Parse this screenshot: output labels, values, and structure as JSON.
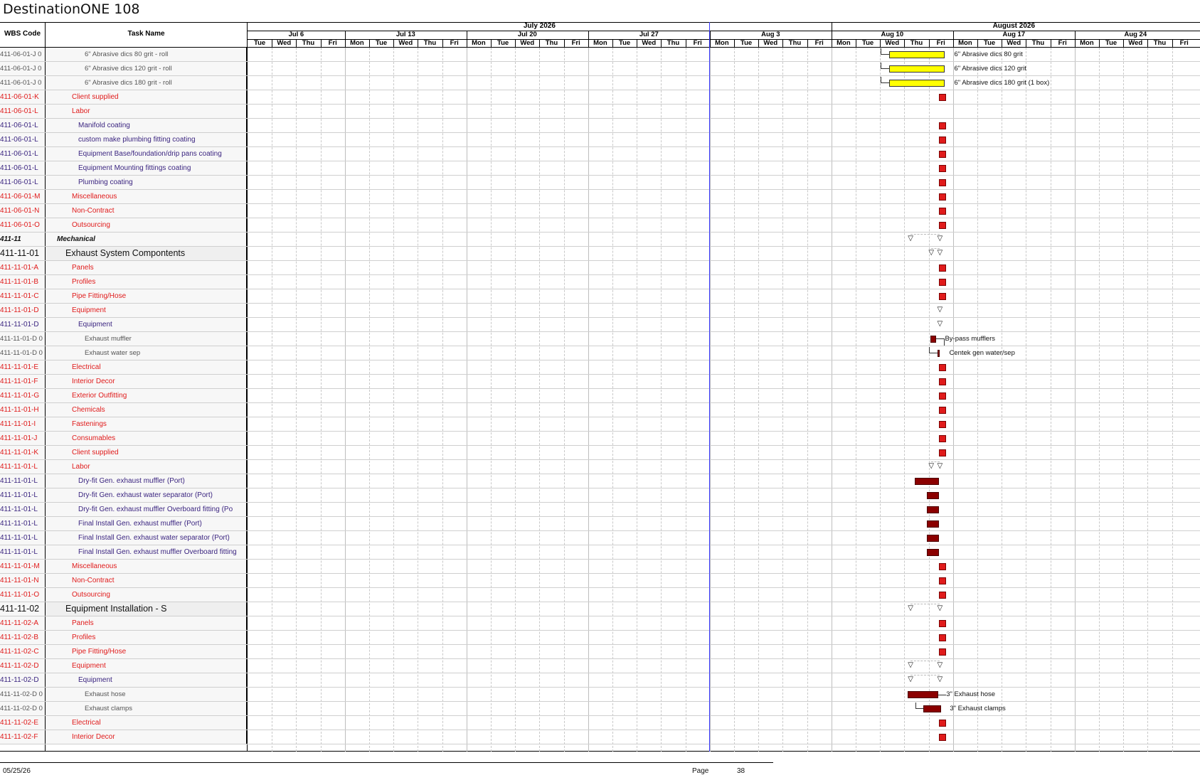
{
  "title": "DestinationONE 108",
  "columns": {
    "wbs": "WBS Code",
    "task": "Task Name"
  },
  "months": [
    "July 2026",
    "August 2026"
  ],
  "weeks": [
    "Jul 6",
    "Jul 13",
    "Jul 20",
    "Jul 27",
    "Aug 3",
    "Aug 10",
    "Aug 17",
    "Aug 24"
  ],
  "day_labels": [
    "Tue",
    "Wed",
    "Thu",
    "Fri",
    "Mon",
    "Tue",
    "Wed",
    "Thu",
    "Fri",
    "Mon",
    "Tue",
    "Wed",
    "Thu",
    "Fri",
    "Mon",
    "Tue",
    "Wed",
    "Thu",
    "Fri",
    "Mon",
    "Tue",
    "Wed",
    "Thu",
    "Fri",
    "Mon",
    "Tue",
    "Wed",
    "Thu",
    "Fri",
    "Mon",
    "Tue",
    "Wed",
    "Thu",
    "Fri",
    "Mon",
    "Tue",
    "Wed",
    "Thu",
    "Fri"
  ],
  "rows": [
    {
      "wbs": "411-06-01-J 0",
      "task": "6\" Abrasive dics 80 grit - roll",
      "style": "gray",
      "indent": 3,
      "bar": {
        "type": "yellow",
        "label": "6\" Abrasive dics 80 grit"
      }
    },
    {
      "wbs": "411-06-01-J 0",
      "task": "6\" Abrasive dics 120 grit - roll",
      "style": "gray",
      "indent": 3,
      "bar": {
        "type": "yellow",
        "label": "6\" Abrasive dics 120 grit"
      }
    },
    {
      "wbs": "411-06-01-J 0",
      "task": "6\" Abrasive dics 180 grit - roll",
      "style": "gray",
      "indent": 3,
      "bar": {
        "type": "yellow",
        "label": "6\" Abrasive dics 180 grit (1 box)"
      }
    },
    {
      "wbs": "411-06-01-K",
      "task": "Client supplied",
      "style": "red",
      "indent": 1,
      "bar": {
        "type": "red"
      }
    },
    {
      "wbs": "411-06-01-L",
      "task": "Labor",
      "style": "red",
      "indent": 1,
      "bar": null
    },
    {
      "wbs": "411-06-01-L",
      "task": "Manifold coating",
      "style": "purple",
      "indent": 2,
      "bar": {
        "type": "red"
      }
    },
    {
      "wbs": "411-06-01-L",
      "task": "custom make plumbing fitting coating",
      "style": "purple",
      "indent": 2,
      "bar": {
        "type": "red"
      }
    },
    {
      "wbs": "411-06-01-L",
      "task": "Equipment Base/foundation/drip pans coating",
      "style": "purple",
      "indent": 2,
      "bar": {
        "type": "red"
      }
    },
    {
      "wbs": "411-06-01-L",
      "task": "Equipment Mounting fittings coating",
      "style": "purple",
      "indent": 2,
      "bar": {
        "type": "red"
      }
    },
    {
      "wbs": "411-06-01-L",
      "task": "Plumbing coating",
      "style": "purple",
      "indent": 2,
      "bar": {
        "type": "red"
      }
    },
    {
      "wbs": "411-06-01-M",
      "task": "Miscellaneous",
      "style": "red",
      "indent": 1,
      "bar": {
        "type": "red"
      }
    },
    {
      "wbs": "411-06-01-N",
      "task": "Non-Contract",
      "style": "red",
      "indent": 1,
      "bar": {
        "type": "red"
      }
    },
    {
      "wbs": "411-06-01-O",
      "task": "Outsourcing",
      "style": "red",
      "indent": 1,
      "bar": {
        "type": "red"
      }
    },
    {
      "wbs": "411-11",
      "task": "Mechanical",
      "style": "section",
      "indent": 0,
      "bar": {
        "type": "summary-wide"
      }
    },
    {
      "wbs": "411-11-01",
      "task": "Exhaust System Compontents",
      "style": "group",
      "indent": 0,
      "bar": {
        "type": "summary-narrow"
      }
    },
    {
      "wbs": "411-11-01-A",
      "task": "Panels",
      "style": "red",
      "indent": 1,
      "bar": {
        "type": "red"
      }
    },
    {
      "wbs": "411-11-01-B",
      "task": "Profiles",
      "style": "red",
      "indent": 1,
      "bar": {
        "type": "red"
      }
    },
    {
      "wbs": "411-11-01-C",
      "task": "Pipe Fitting/Hose",
      "style": "red",
      "indent": 1,
      "bar": {
        "type": "red"
      }
    },
    {
      "wbs": "411-11-01-D",
      "task": "Equipment",
      "style": "red",
      "indent": 1,
      "bar": {
        "type": "summary-single"
      }
    },
    {
      "wbs": "411-11-01-D",
      "task": "Equipment",
      "style": "purple",
      "indent": 2,
      "bar": {
        "type": "summary-single"
      }
    },
    {
      "wbs": "411-11-01-D 0",
      "task": "Exhaust muffler",
      "style": "gray",
      "indent": 3,
      "bar": {
        "type": "dark-small",
        "label": "By-pass mufflers"
      }
    },
    {
      "wbs": "411-11-01-D 0",
      "task": "Exhaust water sep",
      "style": "gray",
      "indent": 3,
      "bar": {
        "type": "dark-thin",
        "label": "Centek gen water/sep"
      }
    },
    {
      "wbs": "411-11-01-E",
      "task": "Electrical",
      "style": "red",
      "indent": 1,
      "bar": {
        "type": "red"
      }
    },
    {
      "wbs": "411-11-01-F",
      "task": "Interior Decor",
      "style": "red",
      "indent": 1,
      "bar": {
        "type": "red"
      }
    },
    {
      "wbs": "411-11-01-G",
      "task": "Exterior Outfitting",
      "style": "red",
      "indent": 1,
      "bar": {
        "type": "red"
      }
    },
    {
      "wbs": "411-11-01-H",
      "task": "Chemicals",
      "style": "red",
      "indent": 1,
      "bar": {
        "type": "red"
      }
    },
    {
      "wbs": "411-11-01-I",
      "task": "Fastenings",
      "style": "red",
      "indent": 1,
      "bar": {
        "type": "red"
      }
    },
    {
      "wbs": "411-11-01-J",
      "task": "Consumables",
      "style": "red",
      "indent": 1,
      "bar": {
        "type": "red"
      }
    },
    {
      "wbs": "411-11-01-K",
      "task": "Client supplied",
      "style": "red",
      "indent": 1,
      "bar": {
        "type": "red"
      }
    },
    {
      "wbs": "411-11-01-L",
      "task": "Labor",
      "style": "red",
      "indent": 1,
      "bar": {
        "type": "summary-narrow"
      }
    },
    {
      "wbs": "411-11-01-L",
      "task": "Dry-fit Gen. exhaust muffler (Port)",
      "style": "purple",
      "indent": 2,
      "bar": {
        "type": "dark-long"
      }
    },
    {
      "wbs": "411-11-01-L",
      "task": "Dry-fit Gen. exhaust water separator (Port)",
      "style": "purple",
      "indent": 2,
      "bar": {
        "type": "dark-med"
      }
    },
    {
      "wbs": "411-11-01-L",
      "task": "Dry-fit Gen. exhaust muffler Overboard fitting (Po",
      "style": "purple",
      "indent": 2,
      "bar": {
        "type": "dark-med"
      }
    },
    {
      "wbs": "411-11-01-L",
      "task": "Final Install  Gen. exhaust muffler (Port)",
      "style": "purple",
      "indent": 2,
      "bar": {
        "type": "dark-med"
      }
    },
    {
      "wbs": "411-11-01-L",
      "task": "Final Install Gen. exhaust water separator (Port)",
      "style": "purple",
      "indent": 2,
      "bar": {
        "type": "dark-med"
      }
    },
    {
      "wbs": "411-11-01-L",
      "task": "Final Install Gen. exhaust muffler Overboard fitting",
      "style": "purple",
      "indent": 2,
      "bar": {
        "type": "dark-med"
      }
    },
    {
      "wbs": "411-11-01-M",
      "task": "Miscellaneous",
      "style": "red",
      "indent": 1,
      "bar": {
        "type": "red"
      }
    },
    {
      "wbs": "411-11-01-N",
      "task": "Non-Contract",
      "style": "red",
      "indent": 1,
      "bar": {
        "type": "red"
      }
    },
    {
      "wbs": "411-11-01-O",
      "task": "Outsourcing",
      "style": "red",
      "indent": 1,
      "bar": {
        "type": "red"
      }
    },
    {
      "wbs": "411-11-02",
      "task": "Equipment Installation - S",
      "style": "group",
      "indent": 0,
      "bar": {
        "type": "summary-wide"
      }
    },
    {
      "wbs": "411-11-02-A",
      "task": "Panels",
      "style": "red",
      "indent": 1,
      "bar": {
        "type": "red"
      }
    },
    {
      "wbs": "411-11-02-B",
      "task": "Profiles",
      "style": "red",
      "indent": 1,
      "bar": {
        "type": "red"
      }
    },
    {
      "wbs": "411-11-02-C",
      "task": "Pipe Fitting/Hose",
      "style": "red",
      "indent": 1,
      "bar": {
        "type": "red"
      }
    },
    {
      "wbs": "411-11-02-D",
      "task": "Equipment",
      "style": "red",
      "indent": 1,
      "bar": {
        "type": "summary-wide"
      }
    },
    {
      "wbs": "411-11-02-D",
      "task": "Equipment",
      "style": "purple",
      "indent": 2,
      "bar": {
        "type": "summary-wide"
      }
    },
    {
      "wbs": "411-11-02-D 0",
      "task": "Exhaust hose",
      "style": "gray",
      "indent": 3,
      "bar": {
        "type": "dark-hose",
        "label": "3\" Exhaust hose"
      }
    },
    {
      "wbs": "411-11-02-D 0",
      "task": "Exhaust clamps",
      "style": "gray",
      "indent": 3,
      "bar": {
        "type": "dark-clamps",
        "label": "3\" Exhaust clamps"
      }
    },
    {
      "wbs": "411-11-02-E",
      "task": "Electrical",
      "style": "red",
      "indent": 1,
      "bar": {
        "type": "red"
      }
    },
    {
      "wbs": "411-11-02-F",
      "task": "Interior Decor",
      "style": "red",
      "indent": 1,
      "bar": {
        "type": "red"
      }
    }
  ],
  "footer": {
    "date": "05/25/26",
    "page_label": "Page",
    "page_number": "38"
  }
}
